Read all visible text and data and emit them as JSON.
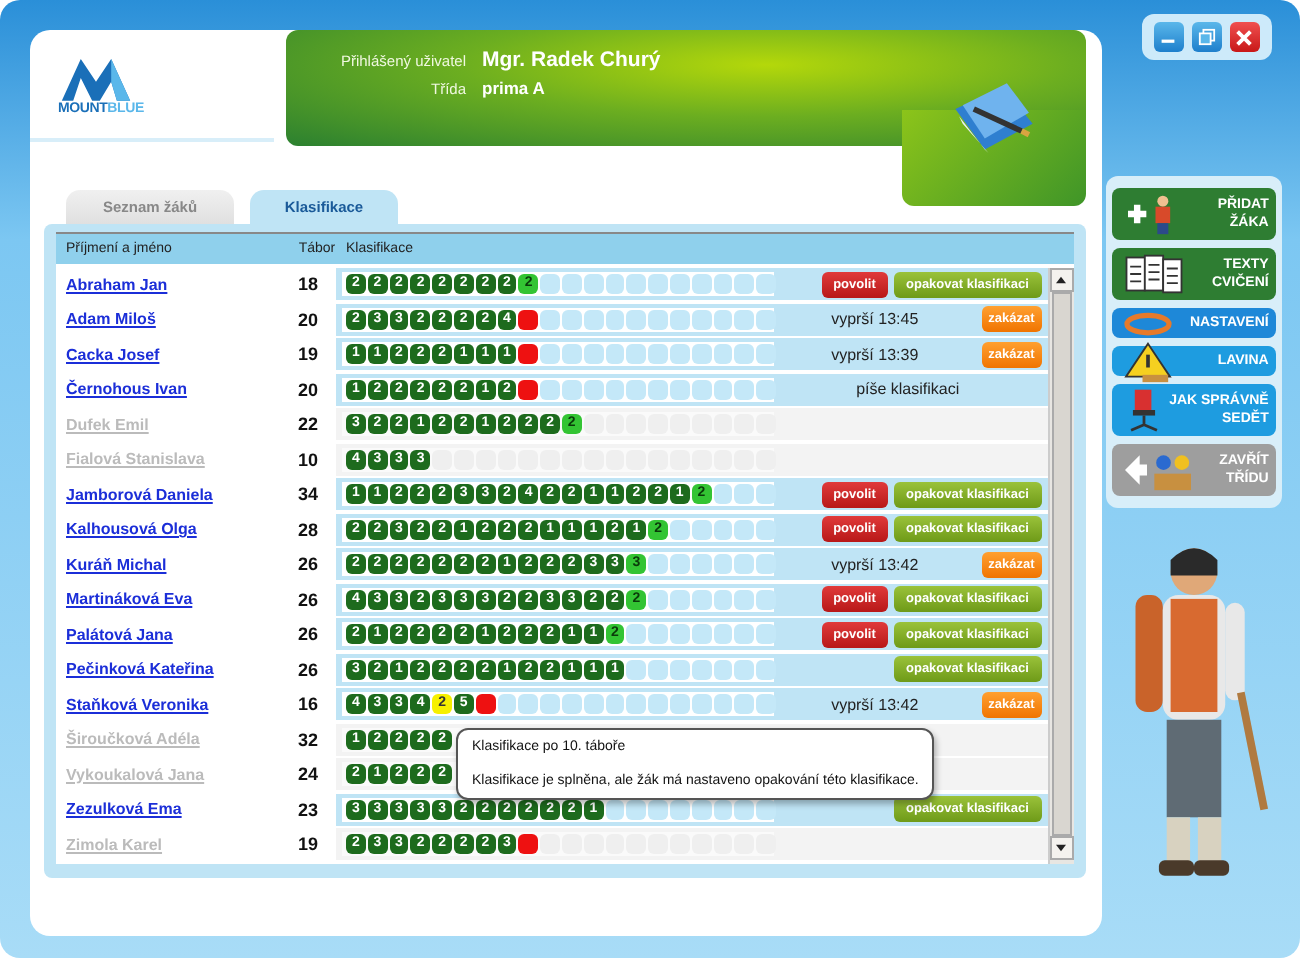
{
  "logo": [
    "MOUNT",
    "BLUE"
  ],
  "header": {
    "user_label": "Přihlášený uživatel",
    "user": "Mgr. Radek Churý",
    "class_label": "Třída",
    "class": "prima A"
  },
  "tabs": [
    {
      "label": "Seznam žáků",
      "selected": false
    },
    {
      "label": "Klasifikace",
      "selected": true
    }
  ],
  "table": {
    "columns": [
      "Příjmení a jméno",
      "Tábor",
      "Klasifikace"
    ],
    "rows": [
      {
        "name": "Abraham Jan",
        "active": true,
        "camp": "18",
        "grades": [
          {
            "value": "2",
            "kind": "passed"
          },
          {
            "value": "2",
            "kind": "passed"
          },
          {
            "value": "2",
            "kind": "passed"
          },
          {
            "value": "2",
            "kind": "passed"
          },
          {
            "value": "2",
            "kind": "passed"
          },
          {
            "value": "2",
            "kind": "passed"
          },
          {
            "value": "2",
            "kind": "passed"
          },
          {
            "value": "2",
            "kind": "passed"
          },
          {
            "value": "2",
            "kind": "current"
          }
        ],
        "buttons": [
          {
            "label": "povolit",
            "kind": "allow"
          },
          {
            "label": "opakovat klasifikaci",
            "kind": "repeat"
          }
        ]
      },
      {
        "name": "Adam Miloš",
        "active": true,
        "camp": "20",
        "grades": [
          {
            "value": "2",
            "kind": "passed"
          },
          {
            "value": "3",
            "kind": "passed"
          },
          {
            "value": "3",
            "kind": "passed"
          },
          {
            "value": "2",
            "kind": "passed"
          },
          {
            "value": "2",
            "kind": "passed"
          },
          {
            "value": "2",
            "kind": "passed"
          },
          {
            "value": "2",
            "kind": "passed"
          },
          {
            "value": "4",
            "kind": "passed"
          },
          {
            "kind": "failed"
          }
        ],
        "status": "vyprší 13:45",
        "buttons": [
          {
            "label": "zakázat",
            "kind": "forbid"
          }
        ]
      },
      {
        "name": "Cacka Josef",
        "active": true,
        "camp": "19",
        "grades": [
          {
            "value": "1",
            "kind": "passed"
          },
          {
            "value": "1",
            "kind": "passed"
          },
          {
            "value": "2",
            "kind": "passed"
          },
          {
            "value": "2",
            "kind": "passed"
          },
          {
            "value": "2",
            "kind": "passed"
          },
          {
            "value": "1",
            "kind": "passed"
          },
          {
            "value": "1",
            "kind": "passed"
          },
          {
            "value": "1",
            "kind": "passed"
          },
          {
            "kind": "failed"
          }
        ],
        "status": "vyprší 13:39",
        "buttons": [
          {
            "label": "zakázat",
            "kind": "forbid"
          }
        ]
      },
      {
        "name": "Černohous Ivan",
        "active": true,
        "camp": "20",
        "grades": [
          {
            "value": "1",
            "kind": "passed"
          },
          {
            "value": "2",
            "kind": "passed"
          },
          {
            "value": "2",
            "kind": "passed"
          },
          {
            "value": "2",
            "kind": "passed"
          },
          {
            "value": "2",
            "kind": "passed"
          },
          {
            "value": "2",
            "kind": "passed"
          },
          {
            "value": "1",
            "kind": "passed"
          },
          {
            "value": "2",
            "kind": "passed"
          },
          {
            "kind": "failed"
          }
        ],
        "status": "píše klasifikaci",
        "buttons": []
      },
      {
        "name": "Dufek Emil",
        "active": false,
        "camp": "22",
        "grades": [
          {
            "value": "3",
            "kind": "passed"
          },
          {
            "value": "2",
            "kind": "passed"
          },
          {
            "value": "2",
            "kind": "passed"
          },
          {
            "value": "1",
            "kind": "passed"
          },
          {
            "value": "2",
            "kind": "passed"
          },
          {
            "value": "2",
            "kind": "passed"
          },
          {
            "value": "1",
            "kind": "passed"
          },
          {
            "value": "2",
            "kind": "passed"
          },
          {
            "value": "2",
            "kind": "passed"
          },
          {
            "value": "2",
            "kind": "passed"
          },
          {
            "value": "2",
            "kind": "current"
          }
        ],
        "buttons": []
      },
      {
        "name": "Fialová Stanislava",
        "active": false,
        "camp": "10",
        "grades": [
          {
            "value": "4",
            "kind": "passed"
          },
          {
            "value": "3",
            "kind": "passed"
          },
          {
            "value": "3",
            "kind": "passed"
          },
          {
            "value": "3",
            "kind": "passed"
          }
        ],
        "buttons": []
      },
      {
        "name": "Jamborová Daniela",
        "active": true,
        "camp": "34",
        "grades": [
          {
            "value": "1",
            "kind": "passed"
          },
          {
            "value": "1",
            "kind": "passed"
          },
          {
            "value": "2",
            "kind": "passed"
          },
          {
            "value": "2",
            "kind": "passed"
          },
          {
            "value": "2",
            "kind": "passed"
          },
          {
            "value": "3",
            "kind": "passed"
          },
          {
            "value": "3",
            "kind": "passed"
          },
          {
            "value": "2",
            "kind": "passed"
          },
          {
            "value": "4",
            "kind": "passed"
          },
          {
            "value": "2",
            "kind": "passed"
          },
          {
            "value": "2",
            "kind": "passed"
          },
          {
            "value": "1",
            "kind": "passed"
          },
          {
            "value": "1",
            "kind": "passed"
          },
          {
            "value": "2",
            "kind": "passed"
          },
          {
            "value": "2",
            "kind": "passed"
          },
          {
            "value": "1",
            "kind": "passed"
          },
          {
            "value": "2",
            "kind": "current"
          }
        ],
        "buttons": [
          {
            "label": "povolit",
            "kind": "allow"
          },
          {
            "label": "opakovat klasifikaci",
            "kind": "repeat"
          }
        ]
      },
      {
        "name": "Kalhousová Olga",
        "active": true,
        "camp": "28",
        "grades": [
          {
            "value": "2",
            "kind": "passed"
          },
          {
            "value": "2",
            "kind": "passed"
          },
          {
            "value": "3",
            "kind": "passed"
          },
          {
            "value": "2",
            "kind": "passed"
          },
          {
            "value": "2",
            "kind": "passed"
          },
          {
            "value": "1",
            "kind": "passed"
          },
          {
            "value": "2",
            "kind": "passed"
          },
          {
            "value": "2",
            "kind": "passed"
          },
          {
            "value": "2",
            "kind": "passed"
          },
          {
            "value": "1",
            "kind": "passed"
          },
          {
            "value": "1",
            "kind": "passed"
          },
          {
            "value": "1",
            "kind": "passed"
          },
          {
            "value": "2",
            "kind": "passed"
          },
          {
            "value": "1",
            "kind": "passed"
          },
          {
            "value": "2",
            "kind": "current"
          }
        ],
        "buttons": [
          {
            "label": "povolit",
            "kind": "allow"
          },
          {
            "label": "opakovat klasifikaci",
            "kind": "repeat"
          }
        ]
      },
      {
        "name": "Kuráň Michal",
        "active": true,
        "camp": "26",
        "grades": [
          {
            "value": "2",
            "kind": "passed"
          },
          {
            "value": "2",
            "kind": "passed"
          },
          {
            "value": "2",
            "kind": "passed"
          },
          {
            "value": "2",
            "kind": "passed"
          },
          {
            "value": "2",
            "kind": "passed"
          },
          {
            "value": "2",
            "kind": "passed"
          },
          {
            "value": "2",
            "kind": "passed"
          },
          {
            "value": "1",
            "kind": "passed"
          },
          {
            "value": "2",
            "kind": "passed"
          },
          {
            "value": "2",
            "kind": "passed"
          },
          {
            "value": "2",
            "kind": "passed"
          },
          {
            "value": "3",
            "kind": "passed"
          },
          {
            "value": "3",
            "kind": "passed"
          },
          {
            "value": "3",
            "kind": "current"
          }
        ],
        "status": "vyprší 13:42",
        "buttons": [
          {
            "label": "zakázat",
            "kind": "forbid"
          }
        ]
      },
      {
        "name": "Martináková Eva",
        "active": true,
        "camp": "26",
        "grades": [
          {
            "value": "4",
            "kind": "passed"
          },
          {
            "value": "3",
            "kind": "passed"
          },
          {
            "value": "3",
            "kind": "passed"
          },
          {
            "value": "2",
            "kind": "passed"
          },
          {
            "value": "3",
            "kind": "passed"
          },
          {
            "value": "3",
            "kind": "passed"
          },
          {
            "value": "3",
            "kind": "passed"
          },
          {
            "value": "2",
            "kind": "passed"
          },
          {
            "value": "2",
            "kind": "passed"
          },
          {
            "value": "3",
            "kind": "passed"
          },
          {
            "value": "3",
            "kind": "passed"
          },
          {
            "value": "2",
            "kind": "passed"
          },
          {
            "value": "2",
            "kind": "passed"
          },
          {
            "value": "2",
            "kind": "current"
          }
        ],
        "buttons": [
          {
            "label": "povolit",
            "kind": "allow"
          },
          {
            "label": "opakovat klasifikaci",
            "kind": "repeat"
          }
        ]
      },
      {
        "name": "Palátová Jana",
        "active": true,
        "camp": "26",
        "grades": [
          {
            "value": "2",
            "kind": "passed"
          },
          {
            "value": "1",
            "kind": "passed"
          },
          {
            "value": "2",
            "kind": "passed"
          },
          {
            "value": "2",
            "kind": "passed"
          },
          {
            "value": "2",
            "kind": "passed"
          },
          {
            "value": "2",
            "kind": "passed"
          },
          {
            "value": "1",
            "kind": "passed"
          },
          {
            "value": "2",
            "kind": "passed"
          },
          {
            "value": "2",
            "kind": "passed"
          },
          {
            "value": "2",
            "kind": "passed"
          },
          {
            "value": "1",
            "kind": "passed"
          },
          {
            "value": "1",
            "kind": "passed"
          },
          {
            "value": "2",
            "kind": "current"
          }
        ],
        "buttons": [
          {
            "label": "povolit",
            "kind": "allow"
          },
          {
            "label": "opakovat klasifikaci",
            "kind": "repeat"
          }
        ]
      },
      {
        "name": "Pečinková Kateřina",
        "active": true,
        "camp": "26",
        "grades": [
          {
            "value": "3",
            "kind": "passed"
          },
          {
            "value": "2",
            "kind": "passed"
          },
          {
            "value": "1",
            "kind": "passed"
          },
          {
            "value": "2",
            "kind": "passed"
          },
          {
            "value": "2",
            "kind": "passed"
          },
          {
            "value": "2",
            "kind": "passed"
          },
          {
            "value": "2",
            "kind": "passed"
          },
          {
            "value": "1",
            "kind": "passed"
          },
          {
            "value": "2",
            "kind": "passed"
          },
          {
            "value": "2",
            "kind": "passed"
          },
          {
            "value": "1",
            "kind": "passed"
          },
          {
            "value": "1",
            "kind": "passed"
          },
          {
            "value": "1",
            "kind": "passed"
          }
        ],
        "buttons": [
          {
            "label": "opakovat klasifikaci",
            "kind": "repeat"
          }
        ]
      },
      {
        "name": "Staňková Veronika",
        "active": true,
        "camp": "16",
        "grades": [
          {
            "value": "4",
            "kind": "passed"
          },
          {
            "value": "3",
            "kind": "passed"
          },
          {
            "value": "3",
            "kind": "passed"
          },
          {
            "value": "4",
            "kind": "passed"
          },
          {
            "value": "2",
            "kind": "repeat"
          },
          {
            "value": "5",
            "kind": "passed"
          },
          {
            "kind": "failed"
          }
        ],
        "status": "vyprší 13:42",
        "buttons": [
          {
            "label": "zakázat",
            "kind": "forbid"
          }
        ],
        "tooltip": {
          "title": "Klasifikace po 10. táboře",
          "text": "Klasifikace je splněna, ale žák má nastaveno opakování této klasifikace."
        }
      },
      {
        "name": "Široučková Adéla",
        "active": false,
        "camp": "32",
        "grades": [
          {
            "value": "1",
            "kind": "passed"
          },
          {
            "value": "2",
            "kind": "passed"
          },
          {
            "value": "2",
            "kind": "passed"
          },
          {
            "value": "2",
            "kind": "passed"
          },
          {
            "value": "2",
            "kind": "passed"
          }
        ],
        "buttons": []
      },
      {
        "name": "Vykoukalová Jana",
        "active": false,
        "camp": "24",
        "grades": [
          {
            "value": "2",
            "kind": "passed"
          },
          {
            "value": "1",
            "kind": "passed"
          },
          {
            "value": "2",
            "kind": "passed"
          },
          {
            "value": "2",
            "kind": "passed"
          },
          {
            "value": "2",
            "kind": "passed"
          }
        ],
        "buttons": []
      },
      {
        "name": "Zezulková Ema",
        "active": true,
        "camp": "23",
        "grades": [
          {
            "value": "3",
            "kind": "passed"
          },
          {
            "value": "3",
            "kind": "passed"
          },
          {
            "value": "3",
            "kind": "passed"
          },
          {
            "value": "3",
            "kind": "passed"
          },
          {
            "value": "3",
            "kind": "passed"
          },
          {
            "value": "2",
            "kind": "passed"
          },
          {
            "value": "2",
            "kind": "passed"
          },
          {
            "value": "2",
            "kind": "passed"
          },
          {
            "value": "2",
            "kind": "passed"
          },
          {
            "value": "2",
            "kind": "passed"
          },
          {
            "value": "2",
            "kind": "passed"
          },
          {
            "value": "1",
            "kind": "passed"
          }
        ],
        "buttons": [
          {
            "label": "opakovat klasifikaci",
            "kind": "repeat"
          }
        ]
      },
      {
        "name": "Zimola Karel",
        "active": false,
        "camp": "19",
        "grades": [
          {
            "value": "2",
            "kind": "passed"
          },
          {
            "value": "3",
            "kind": "passed"
          },
          {
            "value": "3",
            "kind": "passed"
          },
          {
            "value": "2",
            "kind": "passed"
          },
          {
            "value": "2",
            "kind": "passed"
          },
          {
            "value": "2",
            "kind": "passed"
          },
          {
            "value": "2",
            "kind": "passed"
          },
          {
            "value": "3",
            "kind": "passed"
          },
          {
            "kind": "failed"
          }
        ],
        "buttons": []
      }
    ]
  },
  "sidebar": {
    "items": [
      {
        "lines": [
          "PŘIDAT",
          "ŽÁKA"
        ],
        "color": "#2e7d32"
      },
      {
        "lines": [
          "TEXTY",
          "CVIČENÍ"
        ],
        "color": "#2e7d32"
      },
      {
        "lines": [
          "NASTAVENÍ"
        ],
        "color": "#1e88d8"
      },
      {
        "lines": [
          "LAVINA"
        ],
        "color": "#1e9ce0"
      },
      {
        "lines": [
          "JAK SPRÁVNĚ",
          "SEDĚT"
        ],
        "color": "#1e9ce0"
      },
      {
        "lines": [
          "ZAVŘÍT",
          "TŘÍDU"
        ],
        "color": "#9e9e9e"
      }
    ]
  }
}
